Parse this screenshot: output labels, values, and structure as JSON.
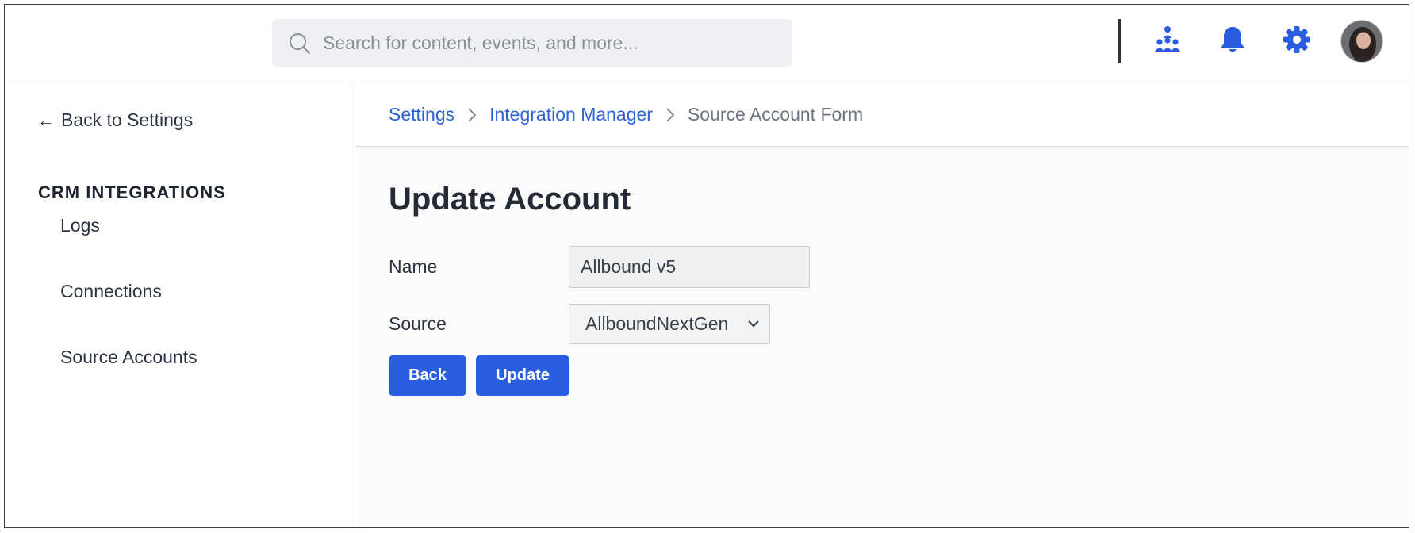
{
  "header": {
    "search_placeholder": "Search for content, events, and more...",
    "icons": [
      "search-icon",
      "hierarchy-icon",
      "bell-icon",
      "gear-icon",
      "avatar"
    ],
    "accent_color": "#2a5ee0"
  },
  "sidebar": {
    "back_label": "Back to Settings",
    "section_title": "CRM INTEGRATIONS",
    "items": [
      {
        "label": "Logs"
      },
      {
        "label": "Connections"
      },
      {
        "label": "Source Accounts"
      }
    ]
  },
  "breadcrumb": {
    "items": [
      "Settings",
      "Integration Manager"
    ],
    "current": "Source Account Form"
  },
  "form": {
    "title": "Update Account",
    "name_label": "Name",
    "name_value": "Allbound v5",
    "source_label": "Source",
    "source_value": "AllboundNextGen",
    "back_button": "Back",
    "update_button": "Update"
  }
}
